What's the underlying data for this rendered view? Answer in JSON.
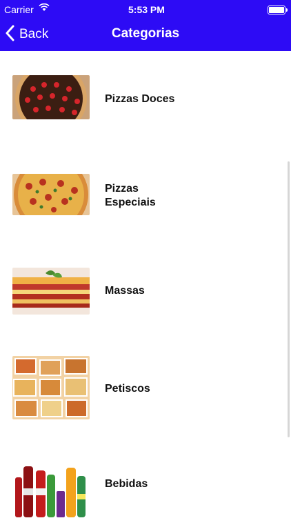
{
  "status_bar": {
    "carrier": "Carrier",
    "time": "5:53 PM"
  },
  "nav": {
    "back_label": "Back",
    "title": "Categorias"
  },
  "categories": [
    {
      "label": "Pizzas Doces"
    },
    {
      "label": "Pizzas Especiais"
    },
    {
      "label": "Massas"
    },
    {
      "label": "Petiscos"
    },
    {
      "label": "Bebidas"
    }
  ],
  "colors": {
    "nav_background": "#2d0bf5",
    "text": "#111111"
  }
}
